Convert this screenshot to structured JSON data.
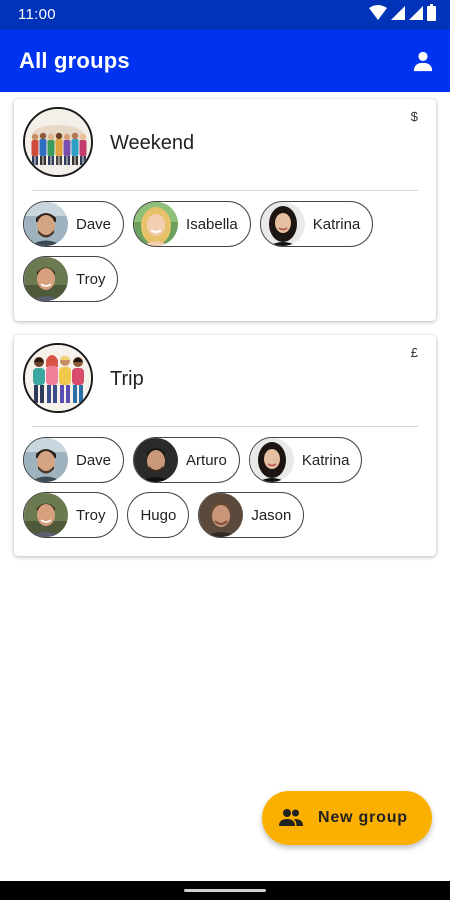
{
  "status_bar": {
    "time": "11:00",
    "icons": [
      "wifi-icon",
      "signal-icon",
      "signal-icon",
      "battery-icon"
    ]
  },
  "app_bar": {
    "title": "All groups",
    "action_icon": "account-icon"
  },
  "groups": [
    {
      "name": "Weekend",
      "currency": "$",
      "avatar_icon": "crowd-avatar-icon",
      "members": [
        {
          "name": "Dave",
          "avatar": "dave"
        },
        {
          "name": "Isabella",
          "avatar": "isabella"
        },
        {
          "name": "Katrina",
          "avatar": "katrina"
        },
        {
          "name": "Troy",
          "avatar": "troy"
        }
      ]
    },
    {
      "name": "Trip",
      "currency": "£",
      "avatar_icon": "people-avatar-icon",
      "members": [
        {
          "name": "Dave",
          "avatar": "dave"
        },
        {
          "name": "Arturo",
          "avatar": "arturo"
        },
        {
          "name": "Katrina",
          "avatar": "katrina"
        },
        {
          "name": "Troy",
          "avatar": "troy"
        },
        {
          "name": "Hugo",
          "avatar": null
        },
        {
          "name": "Jason",
          "avatar": "jason"
        }
      ]
    }
  ],
  "fab": {
    "label": "New group",
    "icon": "group-add-icon"
  },
  "colors": {
    "app_bar": "#0033f0",
    "status_bar": "#0033b8",
    "fab": "#fbb000"
  }
}
